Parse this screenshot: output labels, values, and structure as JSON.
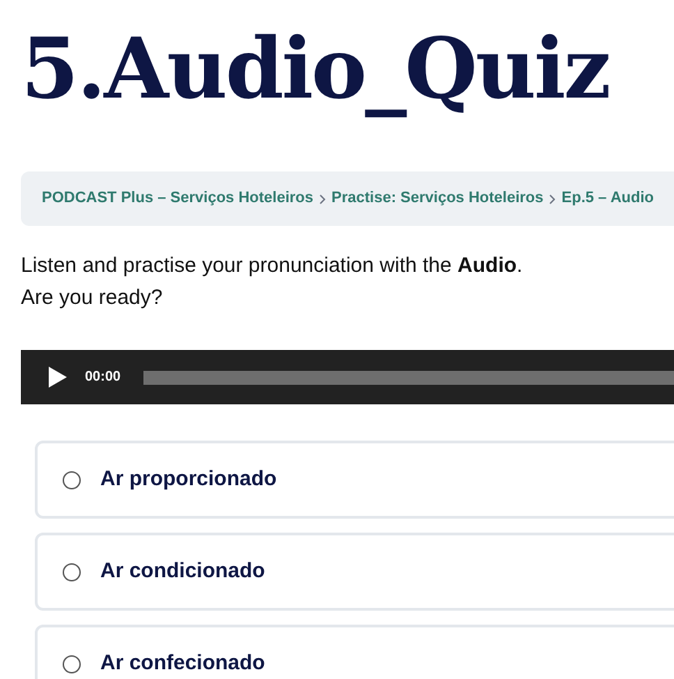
{
  "title": "5.Audio_Quiz",
  "breadcrumb": [
    "PODCAST Plus – Serviços Hoteleiros",
    "Practise: Serviços Hoteleiros",
    "Ep.5 – Audio"
  ],
  "intro": [
    "Listen and practise your pronunciation with the **Audio**.",
    "Are you ready?"
  ],
  "player": {
    "time": "00:00"
  },
  "options": [
    {
      "label": "Ar proporcionado",
      "selected": false
    },
    {
      "label": "Ar condicionado",
      "selected": false
    },
    {
      "label": "Ar confecionado",
      "selected": false
    }
  ]
}
